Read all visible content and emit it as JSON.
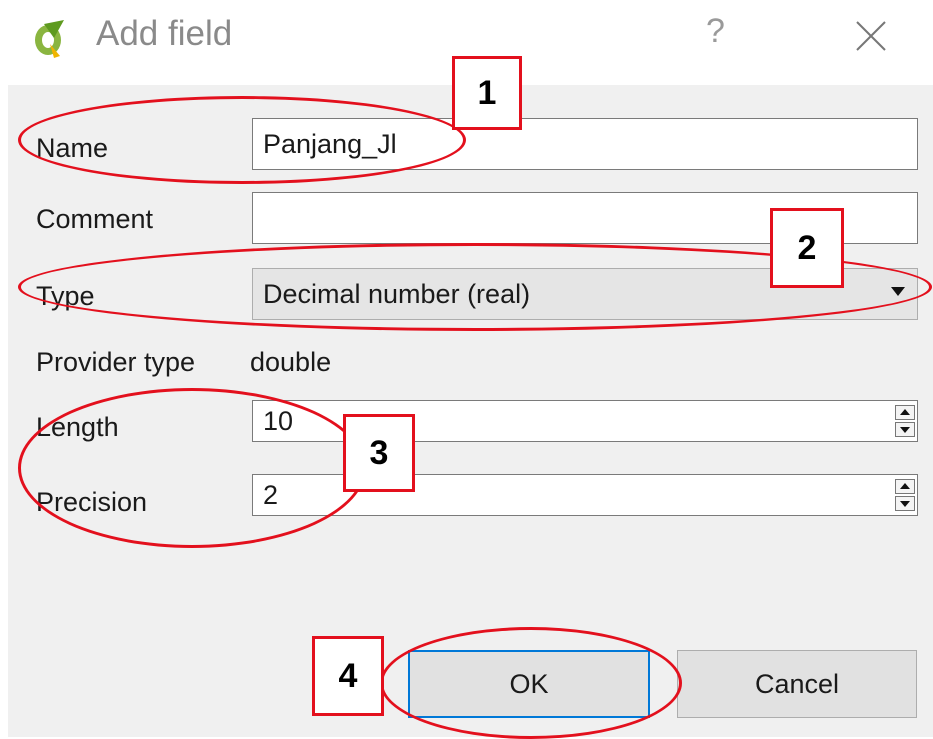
{
  "window": {
    "title": "Add field",
    "help": "?",
    "app_icon": "qgis-logo-icon",
    "close_icon": "close-icon"
  },
  "form": {
    "name_label": "Name",
    "name_value": "Panjang_Jl",
    "comment_label": "Comment",
    "comment_value": "",
    "type_label": "Type",
    "type_value": "Decimal number (real)",
    "provider_label": "Provider type",
    "provider_value": "double",
    "length_label": "Length",
    "length_value": "10",
    "precision_label": "Precision",
    "precision_value": "2"
  },
  "buttons": {
    "ok": "OK",
    "cancel": "Cancel"
  },
  "annotations": {
    "c1": "1",
    "c2": "2",
    "c3": "3",
    "c4": "4",
    "color": "#e3101d"
  }
}
